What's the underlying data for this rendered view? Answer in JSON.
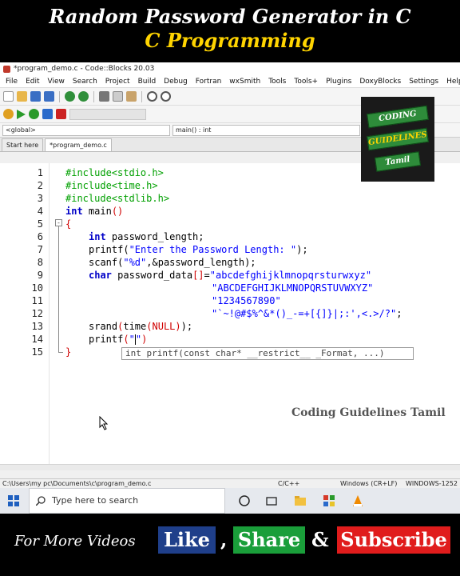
{
  "banner": {
    "title": "Random Password Generator in C",
    "subtitle": "C Programming"
  },
  "window": {
    "title": "*program_demo.c - Code::Blocks 20.03"
  },
  "menu": [
    "File",
    "Edit",
    "View",
    "Search",
    "Project",
    "Build",
    "Debug",
    "Fortran",
    "wxSmith",
    "Tools",
    "Tools+",
    "Plugins",
    "DoxyBlocks",
    "Settings",
    "Help"
  ],
  "scope": {
    "left": "<global>",
    "right": "main() : int"
  },
  "tabs": [
    "Start here",
    "*program_demo.c"
  ],
  "code": {
    "line_numbers": [
      "1",
      "2",
      "3",
      "4",
      "5",
      "6",
      "7",
      "8",
      "9",
      "10",
      "11",
      "12",
      "13",
      "14",
      "15"
    ],
    "inc1": "#include<stdio.h>",
    "inc2": "#include<time.h>",
    "inc3": "#include<stdlib.h>",
    "main_kw": "int",
    "main_rest": " main",
    "main_paren": "()",
    "open_brace": "{",
    "l6_kw": "int",
    "l6_rest": " password_length;",
    "l7_fn": "printf(",
    "l7_str": "\"Enter the Password Length: \"",
    "l7_end": ");",
    "l8_fn": "scanf(",
    "l8_str": "\"%d\"",
    "l8_end": ",&password_length);",
    "l9_kw": "char",
    "l9_rest": " password_data",
    "l9_br": "[]",
    "l9_eq": "=",
    "l9_str": "\"abcdefghijklmnopqrsturwxyz\"",
    "l10_str": "\"ABCDEFGHIJKLMNOPQRSTUVWXYZ\"",
    "l11_str": "\"1234567890\"",
    "l12_str": "\"`~!@#$%^&*()_-=+[{]}|;:',<.>/?\"",
    "l12_end": ";",
    "l13_a": "srand",
    "l13_b": "(",
    "l13_c": "time",
    "l13_d": "(NULL)",
    "l13_e": ");",
    "l14_fn": "printf",
    "l14_paren": "(",
    "l14_quote": "\"",
    "l14_quote2": "\"",
    "l14_close": ")",
    "close_brace": "}",
    "calltip": "int printf(const char* __restrict__ _Format, ...)"
  },
  "watermark": "Coding Guidelines Tamil",
  "logo": {
    "line1": "CODING",
    "line2": "GUIDELINES",
    "line3": "Tamil"
  },
  "status": {
    "path": "C:\\Users\\my pc\\Documents\\c\\program_demo.c",
    "lang": "C/C++",
    "eol": "Windows (CR+LF)",
    "encoding": "WINDOWS-1252"
  },
  "taskbar": {
    "search_placeholder": "Type here to search"
  },
  "promo": {
    "more": "For More Videos",
    "like": "Like",
    "comma": ",",
    "share": "Share",
    "amp": "&",
    "subscribe": "Subscribe"
  },
  "colors": {
    "accent_yellow": "#ffd400",
    "like_bg": "#1f3f8a",
    "share_bg": "#1a9e3a",
    "subscribe_bg": "#e01c1c"
  }
}
